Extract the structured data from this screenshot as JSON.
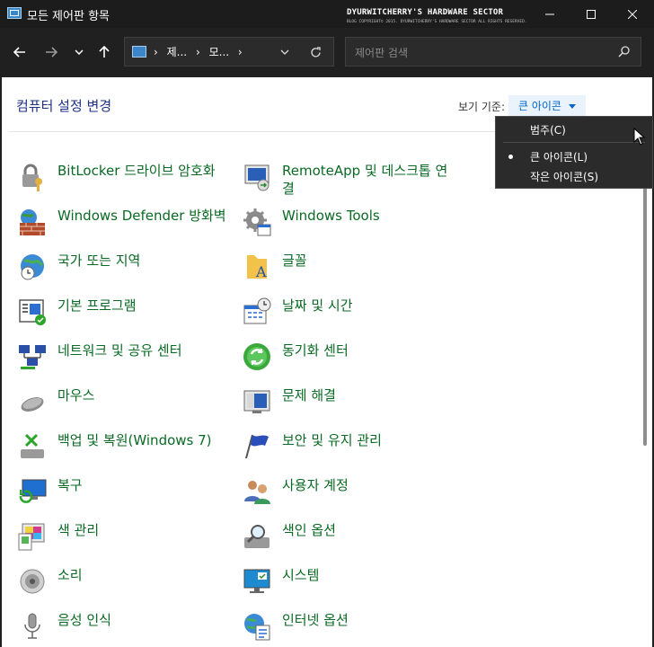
{
  "window": {
    "title": "모든 제어판 항목"
  },
  "watermark": {
    "line1": "DYURWITCHERRY'S HARDWARE SECTOR",
    "line2": "BLOG COPYRIGHT© 2015. DYURWITCHERRY'S HARDWARE SECTOR ALL RIGHTS RESERVED."
  },
  "address": {
    "crumbs": [
      "제...",
      "모..."
    ]
  },
  "search": {
    "placeholder": "제어판 검색",
    "value": ""
  },
  "main": {
    "title": "컴퓨터 설정 변경",
    "viewby_label": "보기 기준:",
    "viewby_value": "큰 아이콘"
  },
  "menu": {
    "items": [
      "범주(C)",
      "큰 아이콘(L)",
      "작은 아이콘(S)"
    ],
    "selected": "큰 아이콘(L)"
  },
  "items_col1": [
    {
      "label": "BitLocker 드라이브 암호화",
      "icon": "bitlocker-icon"
    },
    {
      "label": "Windows Defender 방화벽",
      "icon": "firewall-icon"
    },
    {
      "label": "국가 또는 지역",
      "icon": "globe-clock-icon"
    },
    {
      "label": "기본 프로그램",
      "icon": "default-programs-icon"
    },
    {
      "label": "네트워크 및 공유 센터",
      "icon": "network-icon"
    },
    {
      "label": "마우스",
      "icon": "mouse-icon"
    },
    {
      "label": "백업 및 복원(Windows 7)",
      "icon": "backup-icon"
    },
    {
      "label": "복구",
      "icon": "recovery-icon"
    },
    {
      "label": "색 관리",
      "icon": "color-management-icon"
    },
    {
      "label": "소리",
      "icon": "speaker-icon"
    },
    {
      "label": "음성 인식",
      "icon": "microphone-icon"
    }
  ],
  "items_col2": [
    {
      "label": "RemoteApp 및 데스크톱 연결",
      "icon": "remoteapp-icon"
    },
    {
      "label": "Windows Tools",
      "icon": "gear-icon"
    },
    {
      "label": "글꼴",
      "icon": "font-folder-icon"
    },
    {
      "label": "날짜 및 시간",
      "icon": "calendar-clock-icon"
    },
    {
      "label": "동기화 센터",
      "icon": "sync-icon"
    },
    {
      "label": "문제 해결",
      "icon": "troubleshoot-icon"
    },
    {
      "label": "보안 및 유지 관리",
      "icon": "flag-icon"
    },
    {
      "label": "사용자 계정",
      "icon": "users-icon"
    },
    {
      "label": "색인 옵션",
      "icon": "indexing-icon"
    },
    {
      "label": "시스템",
      "icon": "system-monitor-icon"
    },
    {
      "label": "인터넷 옵션",
      "icon": "internet-options-icon"
    }
  ]
}
